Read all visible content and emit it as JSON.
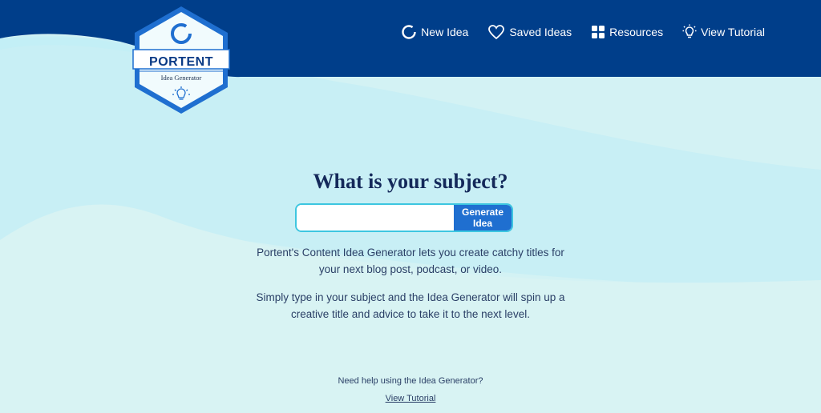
{
  "brand": {
    "name": "PORTENT",
    "tagline": "Idea Generator"
  },
  "nav": {
    "items": [
      {
        "label": "New Idea",
        "icon": "refresh-circle-icon"
      },
      {
        "label": "Saved Ideas",
        "icon": "heart-icon"
      },
      {
        "label": "Resources",
        "icon": "grid-icon"
      },
      {
        "label": "View Tutorial",
        "icon": "lightbulb-icon"
      }
    ]
  },
  "main": {
    "headline": "What is your subject?",
    "subject_input": {
      "value": "",
      "placeholder": ""
    },
    "generate_label": "Generate Idea",
    "description_1": "Portent's Content Idea Generator lets you create catchy titles for your next blog post, podcast, or video.",
    "description_2": "Simply type in your subject and the Idea Generator will spin up a creative title and advice to take it to the next level.",
    "help_text": "Need help using the Idea Generator?",
    "help_link": "View Tutorial"
  },
  "colors": {
    "header_blue": "#003e8a",
    "button_blue": "#1f6fd0",
    "input_border": "#3dc6e0",
    "headline": "#14295a"
  }
}
